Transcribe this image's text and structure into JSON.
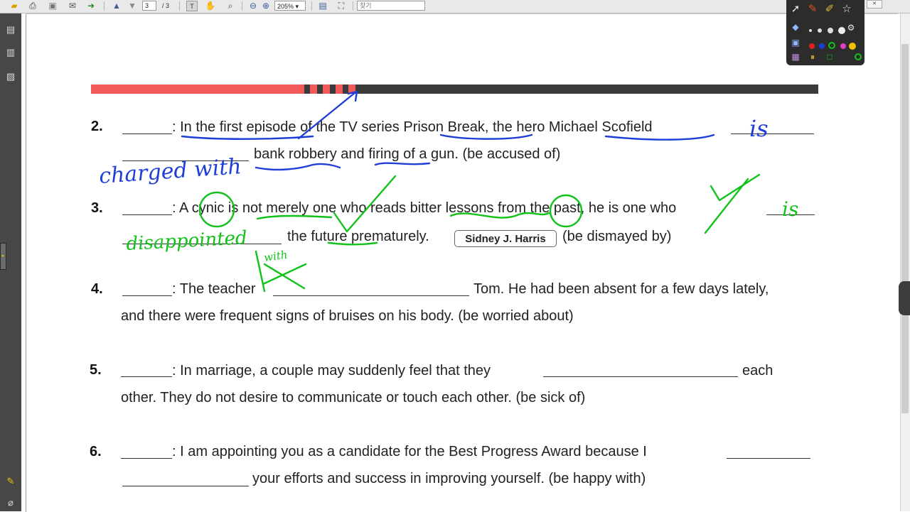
{
  "toolbar": {
    "page_current": "3",
    "page_total": "/ 3",
    "zoom": "205%",
    "find_placeholder": "찾기"
  },
  "exercises": [
    {
      "number": "2.",
      "line1_prefix": ": In the first episode of the TV series Prison Break, the hero Michael Scofield",
      "line2_text": "bank robbery and firing of a gun.  (be accused of)"
    },
    {
      "number": "3.",
      "line1_prefix": ": A cynic is not merely one who reads bitter lessons from the past, he is one who",
      "line2_text": "the future prematurely.",
      "quote_author": "Sidney J. Harris",
      "hint": "(be dismayed by)"
    },
    {
      "number": "4.",
      "line1_prefix": ": The teacher",
      "line1_suffix": "Tom. He had been absent for a few days lately,",
      "line2_text": "and there were frequent signs of bruises on his body. (be worried about)"
    },
    {
      "number": "5.",
      "line1_prefix": ": In marriage, a couple may suddenly feel that they",
      "line1_suffix": "each",
      "line2_text": "other. They do not desire to communicate or touch each other.  (be sick of)"
    },
    {
      "number": "6.",
      "line1_prefix": ": I am appointing you as a candidate for the Best Progress Award because I",
      "line2_text": "your efforts and success in improving yourself. (be happy with)"
    }
  ],
  "handwriting": {
    "ex2_answer_blue": "charged with",
    "ex2_blank_blue": "is",
    "ex3_answer_green": "disappointed",
    "ex3_blank_green": "is",
    "ex3_small_green": "with"
  },
  "colors": {
    "deco_red": "#f25a5a",
    "deco_dark": "#3b3b3b",
    "ink_blue": "#1f3ed8",
    "ink_green": "#12c21a"
  }
}
